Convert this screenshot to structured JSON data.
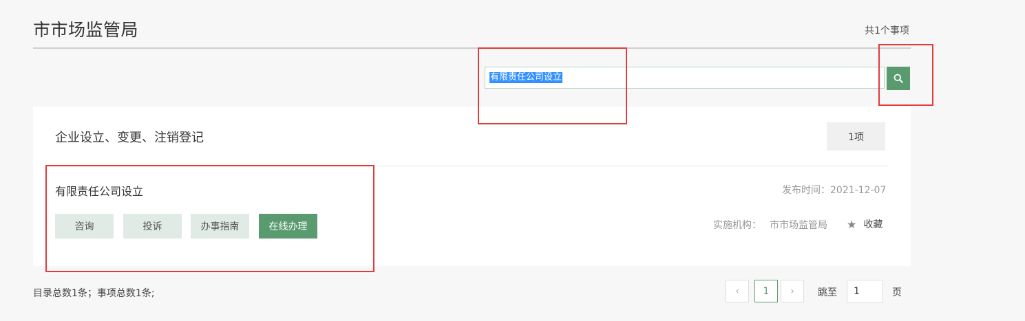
{
  "header": {
    "title": "市市场监管局",
    "total": "共1个事项"
  },
  "search": {
    "value": "有限责任公司设立"
  },
  "category": {
    "title": "企业设立、变更、注销登记",
    "count": "1项"
  },
  "item": {
    "name": "有限责任公司设立",
    "publish_label": "发布时间：",
    "publish_date": "2021-12-07",
    "org_label": "实施机构：",
    "org_value": "市市场监管局",
    "favorite": "收藏",
    "buttons": {
      "consult": "咨询",
      "complain": "投诉",
      "guide": "办事指南",
      "online": "在线办理"
    }
  },
  "footer": {
    "summary": "目录总数1条；事项总数1条;",
    "pagination": {
      "prev": "‹",
      "current": "1",
      "next": "›",
      "jump_label": "跳至",
      "jump_value": "1",
      "page_suffix": "页"
    }
  },
  "colors": {
    "accent": "#5a9a6f",
    "highlight": "#e33a3a",
    "selection": "#3390ff"
  }
}
